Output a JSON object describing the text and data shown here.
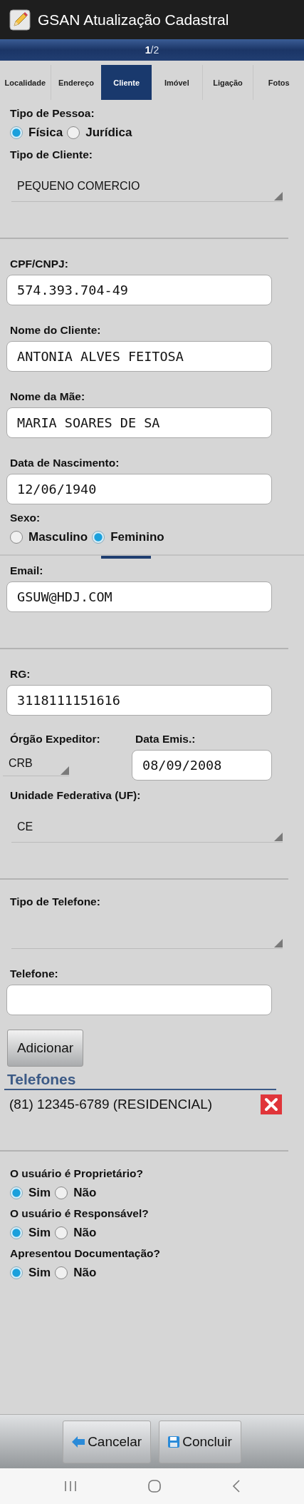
{
  "window": {
    "title": "GSAN Atualização Cadastral"
  },
  "pager": "**1**/2",
  "tabs": [
    {
      "label": "Localidade",
      "selected": false
    },
    {
      "label": "Endereço",
      "selected": false
    },
    {
      "label": "Cliente",
      "selected": true
    },
    {
      "label": "Imóvel",
      "selected": false
    },
    {
      "label": "Ligação",
      "selected": false
    },
    {
      "label": "Fotos",
      "selected": false
    }
  ],
  "form": [
    {
      "kind": "radio_group",
      "label": "Tipo de Pessoa:",
      "options": [
        {
          "label": "Física",
          "selected": true
        },
        {
          "label": "Jurídica",
          "selected": false
        }
      ]
    },
    {
      "kind": "spinner",
      "label": "Tipo de Cliente:",
      "value": "PEQUENO COMERCIO"
    },
    {
      "kind": "separator"
    },
    {
      "kind": "field",
      "label": "CPF/CNPJ:",
      "value": "574.393.704-49"
    },
    {
      "kind": "field",
      "label": "Nome do Cliente:",
      "value": "ANTONIA ALVES FEITOSA"
    },
    {
      "kind": "field",
      "label": "Nome da Mãe:",
      "value": "MARIA SOARES DE SA"
    },
    {
      "kind": "field",
      "label": "Data de Nascimento:",
      "value": "12/06/1940"
    },
    {
      "kind": "radio_group",
      "label": "Sexo:",
      "options": [
        {
          "label": "Masculino",
          "selected": false
        },
        {
          "label": "Feminino",
          "selected": true
        }
      ]
    },
    {
      "kind": "edge"
    },
    {
      "kind": "field",
      "label": "Email:",
      "value": "GSUW@HDJ.COM"
    },
    {
      "kind": "separator"
    },
    {
      "kind": "field",
      "label": "RG:",
      "value": "3118111151616"
    },
    {
      "kind": "pair",
      "left": {
        "label": "Órgão Expeditor:",
        "value": "CRB"
      },
      "right": {
        "label": "Data Emis.:",
        "value": "08/09/2008"
      }
    },
    {
      "kind": "spinner",
      "label": "Unidade Federativa (UF):",
      "value": "CE"
    },
    {
      "kind": "separator"
    },
    {
      "kind": "spinner",
      "label": "Tipo de Telefone:"
    },
    {
      "kind": "field",
      "label": "Telefone:"
    },
    {
      "kind": "button",
      "label": "Adicionar"
    },
    {
      "kind": "list",
      "title": "Telefones",
      "entries": [
        "(81) 12345-6789 (RESIDENCIAL)"
      ]
    },
    {
      "kind": "separator"
    },
    {
      "kind": "radio_group",
      "label": "O usuário é Proprietário?",
      "options": [
        {
          "label": "Sim",
          "selected": true
        },
        {
          "label": "Não",
          "selected": false
        }
      ]
    },
    {
      "kind": "radio_group",
      "label": "O usuário é Responsável?",
      "options": [
        {
          "label": "Sim",
          "selected": true
        },
        {
          "label": "Não",
          "selected": false
        }
      ]
    },
    {
      "kind": "radio_group",
      "label": "Apresentou Documentação?",
      "options": [
        {
          "label": "Sim",
          "selected": true
        },
        {
          "label": "Não",
          "selected": false
        }
      ]
    }
  ],
  "footer": [
    {
      "kind": "back",
      "label": "Cancelar"
    },
    {
      "kind": "save",
      "label": "Concluir"
    }
  ]
}
